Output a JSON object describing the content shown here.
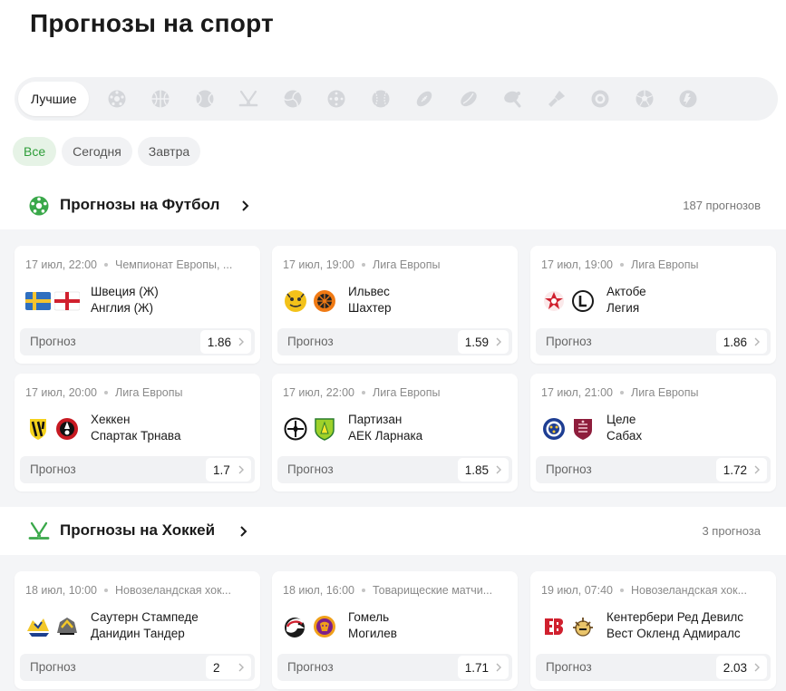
{
  "page_title": "Прогнозы на спорт",
  "sport_tabs": {
    "active_label": "Лучшие",
    "icons": [
      "soccer-ball-icon",
      "basketball-icon",
      "tennis-ball-icon",
      "hockey-sticks-icon",
      "volleyball-icon",
      "handball-icon",
      "baseball-icon",
      "american-football-icon",
      "rugby-ball-icon",
      "table-tennis-icon",
      "badminton-icon",
      "darts-icon",
      "futsal-icon",
      "esports-icon"
    ]
  },
  "date_filters": [
    "Все",
    "Сегодня",
    "Завтра"
  ],
  "football": {
    "title": "Прогнозы на Футбол",
    "count": "187 прогнозов",
    "cards": [
      {
        "date": "17 июл, 22:00",
        "league": "Чемпионат Европы, ...",
        "team1": "Швеция (Ж)",
        "team2": "Англия (Ж)",
        "label": "Прогноз",
        "odds": "1.86"
      },
      {
        "date": "17 июл, 19:00",
        "league": "Лига Европы",
        "team1": "Ильвес",
        "team2": "Шахтер",
        "label": "Прогноз",
        "odds": "1.59"
      },
      {
        "date": "17 июл, 19:00",
        "league": "Лига Европы",
        "team1": "Актобе",
        "team2": "Легия",
        "label": "Прогноз",
        "odds": "1.86"
      },
      {
        "date": "17 июл, 20:00",
        "league": "Лига Европы",
        "team1": "Хеккен",
        "team2": "Спартак Трнава",
        "label": "Прогноз",
        "odds": "1.7"
      },
      {
        "date": "17 июл, 22:00",
        "league": "Лига Европы",
        "team1": "Партизан",
        "team2": "АЕК Ларнака",
        "label": "Прогноз",
        "odds": "1.85"
      },
      {
        "date": "17 июл, 21:00",
        "league": "Лига Европы",
        "team1": "Целе",
        "team2": "Сабах",
        "label": "Прогноз",
        "odds": "1.72"
      }
    ]
  },
  "hockey": {
    "title": "Прогнозы на Хоккей",
    "count": "3 прогноза",
    "cards": [
      {
        "date": "18 июл, 10:00",
        "league": "Новозеландская хок...",
        "team1": "Саутерн Стампеде",
        "team2": "Данидин Тандер",
        "label": "Прогноз",
        "odds": "2"
      },
      {
        "date": "18 июл, 16:00",
        "league": "Товарищеские матчи...",
        "team1": "Гомель",
        "team2": "Могилев",
        "label": "Прогноз",
        "odds": "1.71"
      },
      {
        "date": "19 июл, 07:40",
        "league": "Новозеландская хок...",
        "team1": "Кентербери Ред Девилс",
        "team2": "Вест Окленд Адмиралс",
        "label": "Прогноз",
        "odds": "2.03"
      }
    ]
  },
  "colors": {
    "accent": "#2f9e3a",
    "panel": "#f4f5f7",
    "chip": "#f1f2f4"
  }
}
